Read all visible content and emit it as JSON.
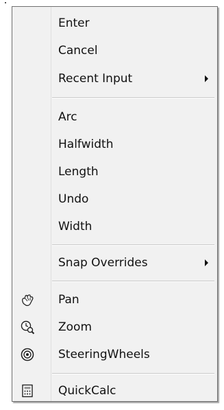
{
  "menu": {
    "items": [
      {
        "label": "Enter"
      },
      {
        "label": "Cancel"
      },
      {
        "label": "Recent Input",
        "submenu": true
      },
      {
        "label": "Arc"
      },
      {
        "label": "Halfwidth"
      },
      {
        "label": "Length"
      },
      {
        "label": "Undo"
      },
      {
        "label": "Width"
      },
      {
        "label": "Snap Overrides",
        "submenu": true
      },
      {
        "label": "Pan",
        "icon": "pan-hand-icon"
      },
      {
        "label": "Zoom",
        "icon": "zoom-clock-magnifier-icon"
      },
      {
        "label": "SteeringWheels",
        "icon": "steering-wheel-icon"
      },
      {
        "label": "QuickCalc",
        "icon": "calculator-icon"
      }
    ]
  }
}
